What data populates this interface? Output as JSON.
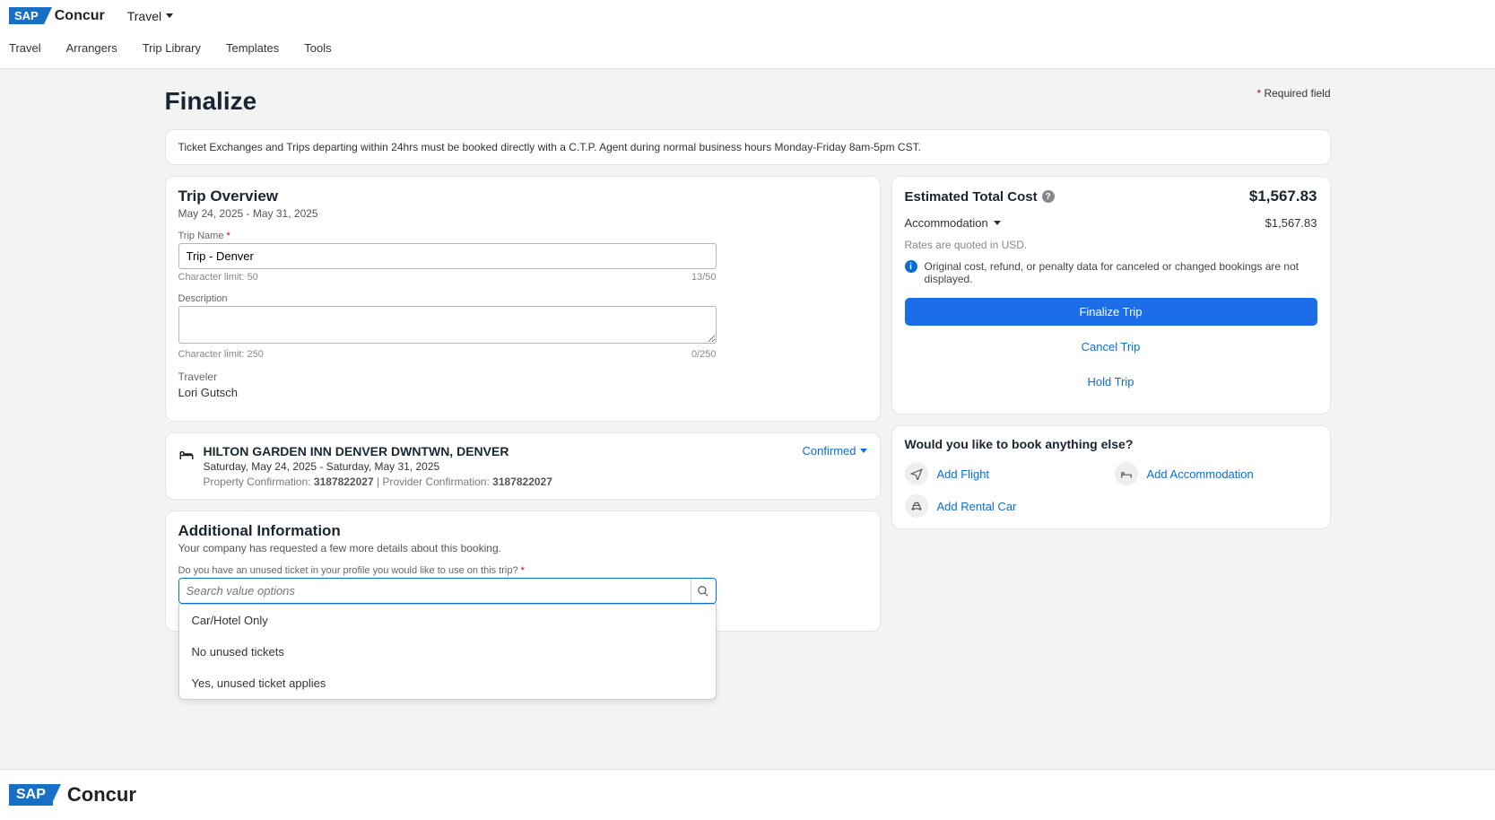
{
  "header": {
    "brand_sap": "SAP",
    "brand_concur": "Concur",
    "product": "Travel"
  },
  "subnav": [
    "Travel",
    "Arrangers",
    "Trip Library",
    "Templates",
    "Tools"
  ],
  "page": {
    "title": "Finalize",
    "required_hint": "Required field"
  },
  "banner": "Ticket Exchanges and Trips departing within 24hrs must be booked directly with a C.T.P. Agent during normal business hours Monday-Friday 8am-5pm CST.",
  "trip_overview": {
    "heading": "Trip Overview",
    "date_range": "May 24, 2025 - May 31, 2025",
    "trip_name_label": "Trip Name",
    "trip_name_value": "Trip - Denver",
    "char_limit_50": "Character limit: 50",
    "char_count_50": "13/50",
    "description_label": "Description",
    "description_value": "",
    "char_limit_250": "Character limit: 250",
    "char_count_250": "0/250",
    "traveler_label": "Traveler",
    "traveler_name": "Lori Gutsch"
  },
  "hotel": {
    "name": "HILTON GARDEN INN DENVER DWNTWN, DENVER",
    "dates": "Saturday, May 24, 2025 - Saturday, May 31, 2025",
    "property_conf_label": "Property Confirmation: ",
    "property_conf_value": "3187822027",
    "separator": " | ",
    "provider_conf_label": "Provider Confirmation: ",
    "provider_conf_value": "3187822027",
    "status": "Confirmed"
  },
  "additional": {
    "heading": "Additional Information",
    "sub": "Your company has requested a few more details about this booking.",
    "question": "Do you have an unused ticket in your profile you would like to use on this trip?",
    "search_placeholder": "Search value options",
    "options": [
      "Car/Hotel Only",
      "No unused tickets",
      "Yes, unused ticket applies"
    ]
  },
  "cost": {
    "title": "Estimated Total Cost",
    "total": "$1,567.83",
    "accommodation_label": "Accommodation",
    "accommodation_value": "$1,567.83",
    "quote_note": "Rates are quoted in USD.",
    "info_note": "Original cost, refund, or penalty data for canceled or changed bookings are not displayed.",
    "finalize_btn": "Finalize Trip",
    "cancel_btn": "Cancel Trip",
    "hold_btn": "Hold Trip"
  },
  "book_else": {
    "title": "Would you like to book anything else?",
    "add_flight": "Add Flight",
    "add_accommodation": "Add Accommodation",
    "add_rental_car": "Add Rental Car"
  }
}
